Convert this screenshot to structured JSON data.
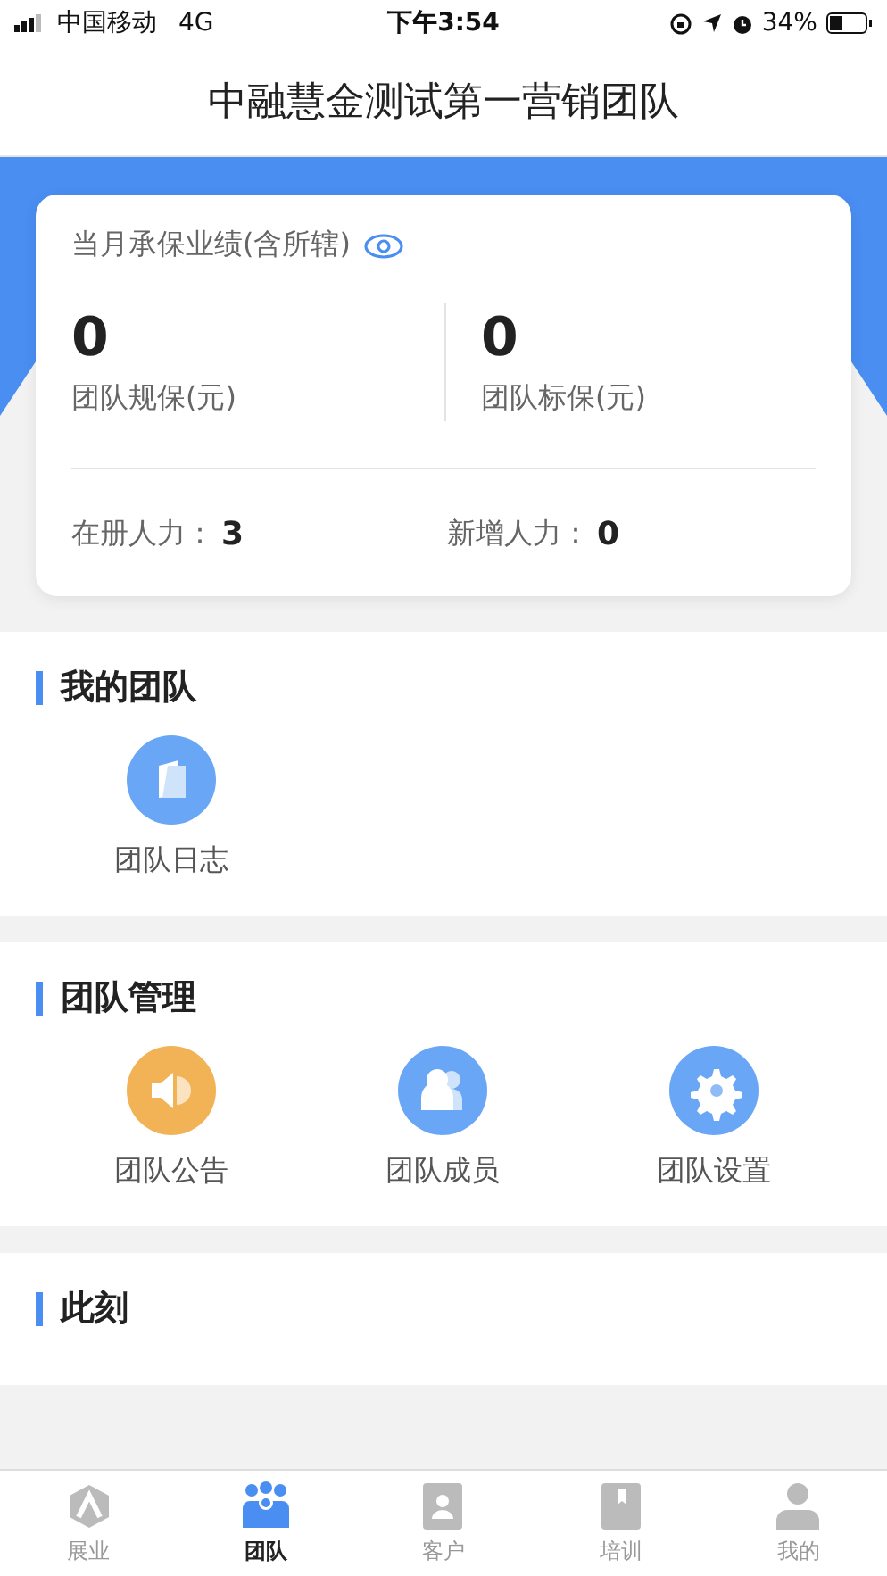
{
  "status_bar": {
    "carrier": "中国移动",
    "network": "4G",
    "time": "下午3:54",
    "battery": "34%"
  },
  "title": "中融慧金测试第一营销团队",
  "summary": {
    "heading": "当月承保业绩(含所辖)",
    "stats": [
      {
        "value": "0",
        "label": "团队规保(元)"
      },
      {
        "value": "0",
        "label": "团队标保(元)"
      }
    ],
    "counts": [
      {
        "label": "在册人力：",
        "value": "3"
      },
      {
        "label": "新增人力：",
        "value": "0"
      }
    ]
  },
  "sections": [
    {
      "title": "我的团队",
      "items": [
        {
          "kind": "journal",
          "label": "团队日志",
          "color": "#69a6f5"
        }
      ]
    },
    {
      "title": "团队管理",
      "items": [
        {
          "kind": "speaker",
          "label": "团队公告",
          "color": "#f2b256"
        },
        {
          "kind": "people",
          "label": "团队成员",
          "color": "#69a6f5"
        },
        {
          "kind": "gear",
          "label": "团队设置",
          "color": "#69a6f5"
        }
      ]
    },
    {
      "title": "此刻"
    }
  ],
  "tab_bar": [
    {
      "kind": "home",
      "label": "展业",
      "selected": false
    },
    {
      "kind": "team",
      "label": "团队",
      "selected": true
    },
    {
      "kind": "client",
      "label": "客户",
      "selected": false
    },
    {
      "kind": "book",
      "label": "培训",
      "selected": false
    },
    {
      "kind": "me",
      "label": "我的",
      "selected": false
    }
  ]
}
